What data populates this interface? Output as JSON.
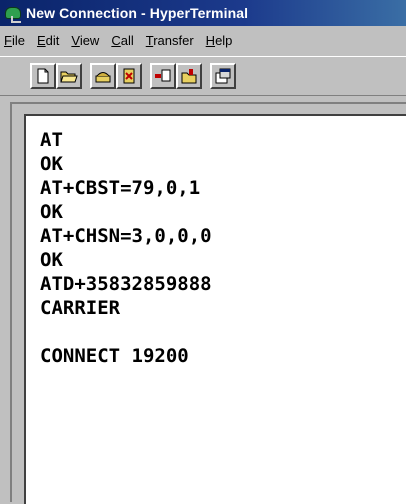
{
  "window": {
    "title": "New Connection - HyperTerminal"
  },
  "menu": [
    "File",
    "Edit",
    "View",
    "Call",
    "Transfer",
    "Help"
  ],
  "toolbar": {
    "buttons": [
      {
        "icon": "new-document-icon"
      },
      {
        "icon": "open-folder-icon"
      },
      {
        "icon": "connect-phone-icon"
      },
      {
        "icon": "disconnect-icon"
      },
      {
        "icon": "send-file-icon"
      },
      {
        "icon": "receive-file-icon"
      },
      {
        "icon": "properties-icon"
      }
    ]
  },
  "terminal": {
    "lines": [
      "AT",
      "OK",
      "AT+CBST=79,0,1",
      "OK",
      "AT+CHSN=3,0,0,0",
      "OK",
      "ATD+35832859888",
      "CARRIER",
      "",
      "CONNECT 19200"
    ]
  }
}
